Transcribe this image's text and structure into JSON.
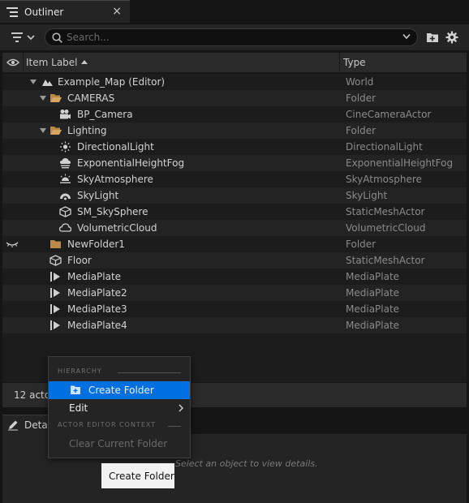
{
  "tab": {
    "title": "Outliner",
    "close_glyph": "×"
  },
  "toolbar": {
    "search_placeholder": "Search...",
    "filter_icon": "filter-icon",
    "new_folder_icon": "new-folder-icon",
    "settings_icon": "gear-icon"
  },
  "columns": {
    "label": "Item Label",
    "type": "Type"
  },
  "tree": {
    "rows": [
      {
        "label": "Example_Map (Editor)",
        "type": "World",
        "icon": "map-icon"
      },
      {
        "label": "CAMERAS",
        "type": "Folder",
        "icon": "folder-icon"
      },
      {
        "label": "BP_Camera",
        "type": "CineCameraActor",
        "icon": "camera-icon"
      },
      {
        "label": "Lighting",
        "type": "Folder",
        "icon": "folder-icon"
      },
      {
        "label": "DirectionalLight",
        "type": "DirectionalLight",
        "icon": "sun-icon"
      },
      {
        "label": "ExponentialHeightFog",
        "type": "ExponentialHeightFog",
        "icon": "fog-icon"
      },
      {
        "label": "SkyAtmosphere",
        "type": "SkyAtmosphere",
        "icon": "sky-atmosphere-icon"
      },
      {
        "label": "SkyLight",
        "type": "SkyLight",
        "icon": "skylight-icon"
      },
      {
        "label": "SM_SkySphere",
        "type": "StaticMeshActor",
        "icon": "static-mesh-icon"
      },
      {
        "label": "VolumetricCloud",
        "type": "VolumetricCloud",
        "icon": "cloud-icon"
      },
      {
        "label": "NewFolder1",
        "type": "Folder",
        "icon": "folder-icon"
      },
      {
        "label": "Floor",
        "type": "StaticMeshActor",
        "icon": "static-mesh-icon"
      },
      {
        "label": "MediaPlate",
        "type": "MediaPlate",
        "icon": "media-plate-icon"
      },
      {
        "label": "MediaPlate2",
        "type": "MediaPlate",
        "icon": "media-plate-icon"
      },
      {
        "label": "MediaPlate3",
        "type": "MediaPlate",
        "icon": "media-plate-icon"
      },
      {
        "label": "MediaPlate4",
        "type": "MediaPlate",
        "icon": "media-plate-icon"
      }
    ]
  },
  "status": {
    "actor_count": "12 acto"
  },
  "details": {
    "tab_label": "Detai",
    "hint": "Select an object to view details."
  },
  "context_menu": {
    "section_hierarchy": "HIERARCHY",
    "create_folder": "Create Folder",
    "edit": "Edit",
    "section_actor_editor": "ACTOR EDITOR CONTEXT",
    "clear_current_folder": "Clear Current Folder"
  },
  "tooltip": {
    "text": "Create Folder"
  },
  "colors": {
    "highlight": "#0070e0",
    "folder": "#b98a4a",
    "panel": "#242424",
    "tree_bg": "#1c1c1c"
  }
}
